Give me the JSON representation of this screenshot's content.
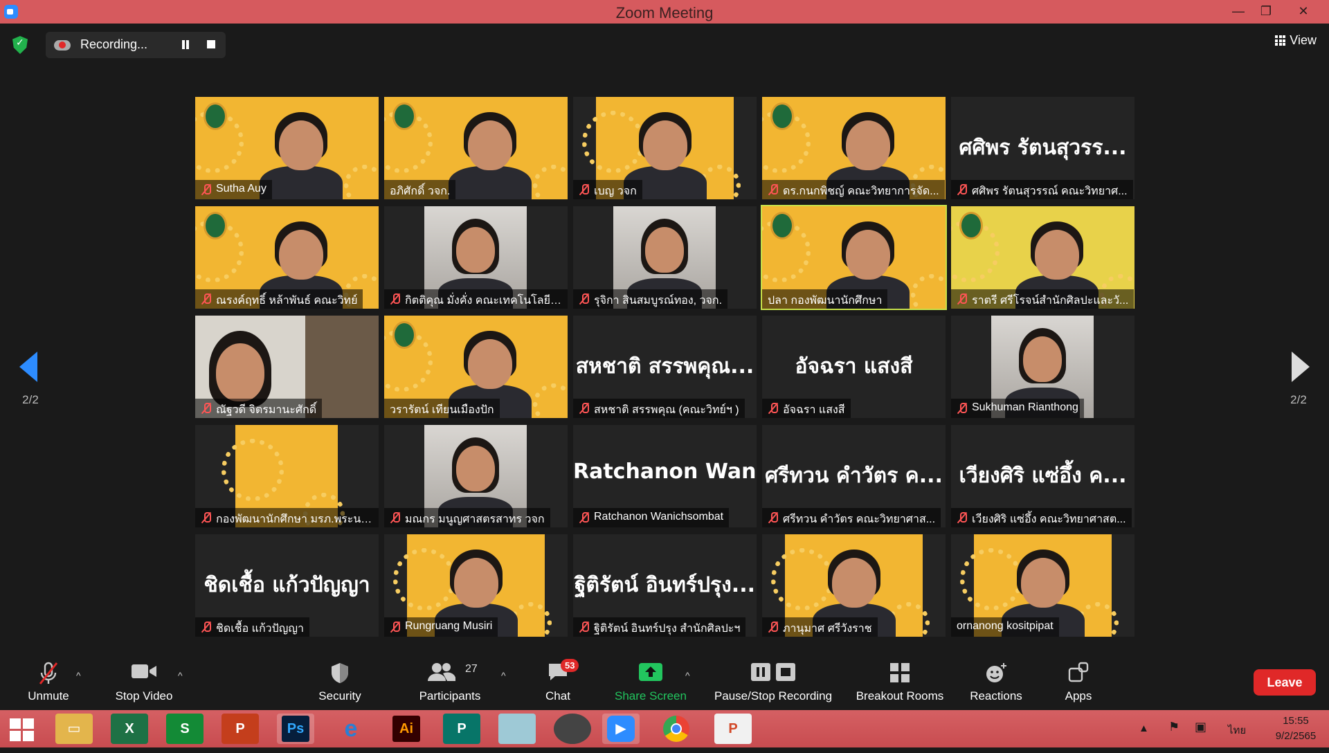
{
  "window": {
    "title": "Zoom Meeting",
    "minimize": "—",
    "restore": "❐",
    "close": "✕"
  },
  "topbar": {
    "recording_label": "Recording...",
    "view_label": "View"
  },
  "pager": {
    "left_page": "2/2",
    "right_page": "2/2"
  },
  "participants": [
    {
      "name": "Sutha Auy",
      "big": "",
      "kind": "slide",
      "muted": true
    },
    {
      "name": "อภิศักดิ์ วจก.",
      "big": "",
      "kind": "slide",
      "muted": false
    },
    {
      "name": "เบญ วจก",
      "big": "",
      "kind": "slide-center",
      "muted": true
    },
    {
      "name": "ดร.กนกพิชญ์ คณะวิทยาการจัด...",
      "big": "",
      "kind": "slide",
      "muted": true
    },
    {
      "name": "ศศิพร รัตนสุวรรณ์ คณะวิทยาศ...",
      "big": "ศศิพร รัตนสุวรร...",
      "kind": "text",
      "muted": true
    },
    {
      "name": "ณรงค์ฤทธิ์ หล้าพันธ์ คณะวิทย์",
      "big": "",
      "kind": "slide",
      "muted": true
    },
    {
      "name": "กิตติคุณ มั่งคั่ง คณะเทคโนโลยีอุ...",
      "big": "",
      "kind": "photo-center",
      "muted": true
    },
    {
      "name": "รุจิกา สินสมบูรณ์ทอง, วจก.",
      "big": "",
      "kind": "photo-center",
      "muted": true
    },
    {
      "name": "ปลา กองพัฒนานักศึกษา",
      "big": "",
      "kind": "slide",
      "muted": false,
      "active": true
    },
    {
      "name": "ราตรี   ศรีโรจน์สำนักศิลปะและวั...",
      "big": "",
      "kind": "slide2",
      "muted": true
    },
    {
      "name": "ณัฐวดี จิตรมานะศักดิ์",
      "big": "",
      "kind": "office",
      "muted": true
    },
    {
      "name": "วรารัตน์ เทียนเมืองปัก",
      "big": "",
      "kind": "slide",
      "muted": false
    },
    {
      "name": "สหชาติ สรรพคุณ (คณะวิทย์ฯ )",
      "big": "สหชาติ สรรพคุณ...",
      "kind": "text",
      "muted": true
    },
    {
      "name": "อัจฉรา แสงสี",
      "big": "อัจฉรา แสงสี",
      "kind": "text",
      "muted": true
    },
    {
      "name": "Sukhuman Rianthong",
      "big": "",
      "kind": "photo-center",
      "muted": true
    },
    {
      "name": "กองพัฒนานักศึกษา มรภ.พระนคร",
      "big": "",
      "kind": "logo-center",
      "muted": true
    },
    {
      "name": "มณกร มนูญศาสตรสาทร วจก",
      "big": "",
      "kind": "photo-center",
      "muted": true
    },
    {
      "name": "Ratchanon Wanichsombat",
      "big": "Ratchanon  Wan...",
      "kind": "text",
      "muted": true
    },
    {
      "name": "ศรีทวน  คำวัตร คณะวิทยาศาส...",
      "big": "ศรีทวน  คำวัตร ค...",
      "kind": "text",
      "muted": true
    },
    {
      "name": "เวียงศิริ  แซ่อึ้ง  คณะวิทยาศาสต...",
      "big": "เวียงศิริ  แซ่อึ้ง  ค...",
      "kind": "text",
      "muted": true
    },
    {
      "name": "ชิดเชื้อ แก้วปัญญา",
      "big": "ชิดเชื้อ แก้วปัญญา",
      "kind": "text",
      "muted": true
    },
    {
      "name": "Rungruang Musiri",
      "big": "",
      "kind": "slide-center",
      "muted": true
    },
    {
      "name": "ฐิติรัตน์ อินทร์ปรุง สำนักศิลปะฯ",
      "big": "ฐิติรัตน์ อินทร์ปรุง...",
      "kind": "text",
      "muted": true
    },
    {
      "name": "ภานุมาศ ศรีวังราช",
      "big": "",
      "kind": "slide-center",
      "muted": true
    },
    {
      "name": "ornanong kositpipat",
      "big": "",
      "kind": "slide-center",
      "muted": false
    }
  ],
  "toolbar": {
    "unmute": "Unmute",
    "stop_video": "Stop Video",
    "security": "Security",
    "participants": "Participants",
    "participants_count": "27",
    "chat": "Chat",
    "chat_badge": "53",
    "share_screen": "Share Screen",
    "pause_stop": "Pause/Stop Recording",
    "breakout": "Breakout Rooms",
    "reactions": "Reactions",
    "apps": "Apps",
    "leave": "Leave"
  },
  "taskbar": {
    "lang": "ไทย",
    "time": "15:55",
    "date": "9/2/2565",
    "apps": [
      "excel",
      "sway",
      "powerpoint",
      "photoshop",
      "internet-explorer",
      "illustrator",
      "publisher",
      "blank",
      "photoscape",
      "zoom",
      "chrome",
      "ppt-viewer"
    ]
  },
  "colors": {
    "titlebar": "#d65a5e",
    "accent": "#2d8cff",
    "leave": "#e02828",
    "active_speaker": "#c6e04a",
    "slide_yellow": "#f2b632"
  }
}
